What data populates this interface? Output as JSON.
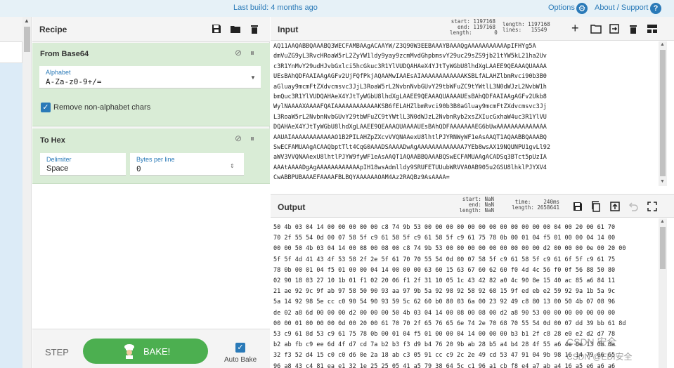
{
  "banner": {
    "build": "Last build: 4 months ago",
    "options": "Options",
    "about": "About / Support",
    "help": "?"
  },
  "colors": {
    "accent": "#2a7ab8",
    "operation_bg": "#d9ecd6",
    "bake": "#4caf50"
  },
  "recipe": {
    "title": "Recipe",
    "operations": [
      {
        "name": "From Base64",
        "alphabet_label": "Alphabet",
        "alphabet_value": "A-Za-z0-9+/=",
        "checkbox_label": "Remove non-alphabet chars",
        "checked": true
      },
      {
        "name": "To Hex",
        "delimiter_label": "Delimiter",
        "delimiter_value": "Space",
        "bpl_label": "Bytes per line",
        "bpl_value": "0"
      }
    ],
    "step": "STEP",
    "bake": "BAKE!",
    "auto_bake": "Auto Bake"
  },
  "input": {
    "title": "Input",
    "stats_left": "start: 1197168\nend: 1197168\nlength:       0",
    "stats_right": "length: 1197168\nlines:   15549",
    "lines": [
      "AQ11AAQABBQAAABQ3WECFAMBAAgACAAYW/Z3Q90W3EEBAAAYBAAAQgAAAAAAAAAAApIFHYg5A",
      "dmVuZG9yL3RvcHRoaW5rL2ZyYW1ldy9yay9zcmMvdGhpbmsvY29uc29sZS9jb21tYW5kL21ha2Uv",
      "c3R1YnMvY29udHJvbGxlci5hcGkuc3R1YlVUDQAHAeX4YJtTyWGbU8lhdXgLAAEE9QEAAAQUAAAA",
      "UEsBAhQDFAAIAAgAGFv2UjFQfPkjAQAAMwIAAEsAIAAAAAAAAAAAAKSBLfALAHZlbmRvci90b3B0",
      "aGluay9mcmFtZXdvcmsvc3JjL3RoaW5rL2NvbnNvbGUvY29tbWFuZC9tYWtlL3N0dWJzL2NvbW1h",
      "bmQuc3R1YlVUDQAHAeX4YJtTyWGbU8lhdXgLAAEE9QEAAAQUAAAAUEsBAhQDFAAIAAgAGFv2Ukb8",
      "WylNAAAAXAAAAFQAIAAAAAAAAAAAAKSB6fELAHZlbmRvci90b3B0aGluay9mcmFtZXdvcmsvc3Jj",
      "L3RoaW5rL2NvbnNvbGUvY29tbWFuZC9tYWtlL3N0dWJzL2NvbnRyb2xsZXIucGxhaW4uc3R1YlVU",
      "DQAHAeX4YJtTyWGbU8lhdXgLAAEE9QEAAAQUAAAAUEsBAhQDFAAAAAAAEG6bUwAAAAAAAAAAAAAA",
      "AAUAIAAAAAAAAAAAAO1B2PILAHZpZXcvVVQNAAexU8lhtlPJYRNWyWF1eAsAAQT1AQAABBQAAABQ",
      "SwECFAMUAAgACAAQbptTlt4CqG0AAADSAAAADwAgAAAAAAAAAAAAA7YEb8wsAX19NQUNPU1gvLl92",
      "aWV3VVQNAAexU8lhtlPJYW9fyWF1eAsAAQT1AQAABBQAAABQSwECFAMUAAgACADSq3BTct5pUzIA",
      "AAAtAAAADgAgAAAAAAAAAAAApIH18wsAdmlldy9SRUFETUUubWRVVA0AB905u2GSU8lhklPJYXV4",
      "CwABBPUBAAAEFAAAAFBLBQYAAAAAAOAM4Az2RAQBz9AsAAAA="
    ]
  },
  "output": {
    "title": "Output",
    "stats_left": "start: NaN\nend: NaN\nlength: NaN",
    "stats_right": "time:    240ms\nlength: 2658641",
    "lines": [
      "50 4b 03 04 14 00 00 00 00 00 c8 74 9b 53 00 00 00 00 00 00 00 00 00 00 00 00 04 00 20 00 61 70",
      "70 2f 55 54 0d 00 07 58 5f c9 61 58 5f c9 61 58 5f c9 61 75 78 0b 00 01 04 f5 01 00 00 04 14 00",
      "00 00 50 4b 03 04 14 00 08 00 08 00 c8 74 9b 53 00 00 00 00 00 00 00 00 00 d2 00 00 00 0e 00 20 00",
      "5f 5f 4d 41 43 4f 53 58 2f 2e 5f 61 70 70 55 54 0d 00 07 58 5f c9 61 58 5f c9 61 6f 5f c9 61 75",
      "78 0b 00 01 04 f5 01 00 00 04 14 00 00 00 63 60 15 63 67 60 62 60 f0 4d 4c 56 f0 0f 56 88 50 80",
      "02 90 18 03 27 10 1b 01 f1 02 20 06 f1 2f 31 10 05 1c 43 42 82 a0 4c 90 8e 15 40 ac 85 a6 84 11",
      "21 ae 92 9c 9f ab 97 58 50 90 93 aa 97 9b 5a 92 98 92 58 92 68 15 9f ed eb e2 59 92 9a 1b 5a 9c",
      "5a 14 92 98 5e cc c0 90 54 90 93 59 5c 62 60 b0 80 03 6a 00 23 92 49 c8 80 13 00 50 4b 07 08 96",
      "de 02 a8 6d 00 00 00 d2 00 00 00 50 4b 03 04 14 00 08 00 08 00 d2 a8 90 53 00 00 00 00 00 00 00",
      "00 00 01 00 00 00 0d 00 20 00 61 70 70 2f 65 76 65 6e 74 2e 70 68 70 55 54 0d 00 07 dd 39 bb 61 8d",
      "53 c9 61 8d 53 c9 61 75 78 0b 00 01 04 f5 01 00 00 04 14 00 00 00 b3 b1 2f c8 28 e0 e2 d2 d7 78",
      "b2 ab fb c9 ee 6d 4f d7 cd 7a b2 b3 f3 d9 b4 76 20 9b ab 28 b5 a4 b4 28 4f 55 a6 4e 6e 13 0b 0a",
      "32 f3 52 d4 15 c0 c0 d6 0e 2a 18 ab c3 05 91 cc c9 2c 2e 49 cd 53 47 91 04 9b 98 16 14 79 66 65",
      "96 a8 43 c4 81 ea e1 32 1e 25 25 05 41 a5 79 38 64 5c c1 96 a1 cb f8 e4 a7 ab a4 16 a5 e6 a6 a6"
    ]
  },
  "watermark": {
    "line1": "CSDN 安全",
    "line2": "CSDN @EDI安全"
  }
}
